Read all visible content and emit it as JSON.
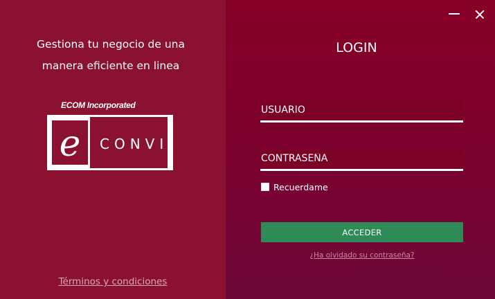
{
  "left": {
    "tagline_line1": "Gestiona tu negocio de una",
    "tagline_line2": "manera eficiente en linea",
    "company_label": "ECOM Incorporated",
    "logo_letter": "e",
    "logo_text": "CONVI",
    "terms_link": "Términos y condiciones"
  },
  "window_controls": {
    "minimize_icon": "minimize-icon",
    "close_icon": "close-icon"
  },
  "login": {
    "title": "LOGIN",
    "username_placeholder": "USUARIO",
    "password_placeholder": "CONTRASEÑA",
    "remember_label": "Recuerdame",
    "remember_checked": false,
    "submit_label": "ACCEDER",
    "forgot_link": "¿Ha olvidado su contraseña?"
  },
  "colors": {
    "left_panel": "#8a1130",
    "right_panel_top": "#870026",
    "right_panel_bottom": "#6c0838",
    "field_background": "#7c0126",
    "accent_button": "#2e8b57",
    "link_muted": "#c98aa1"
  }
}
